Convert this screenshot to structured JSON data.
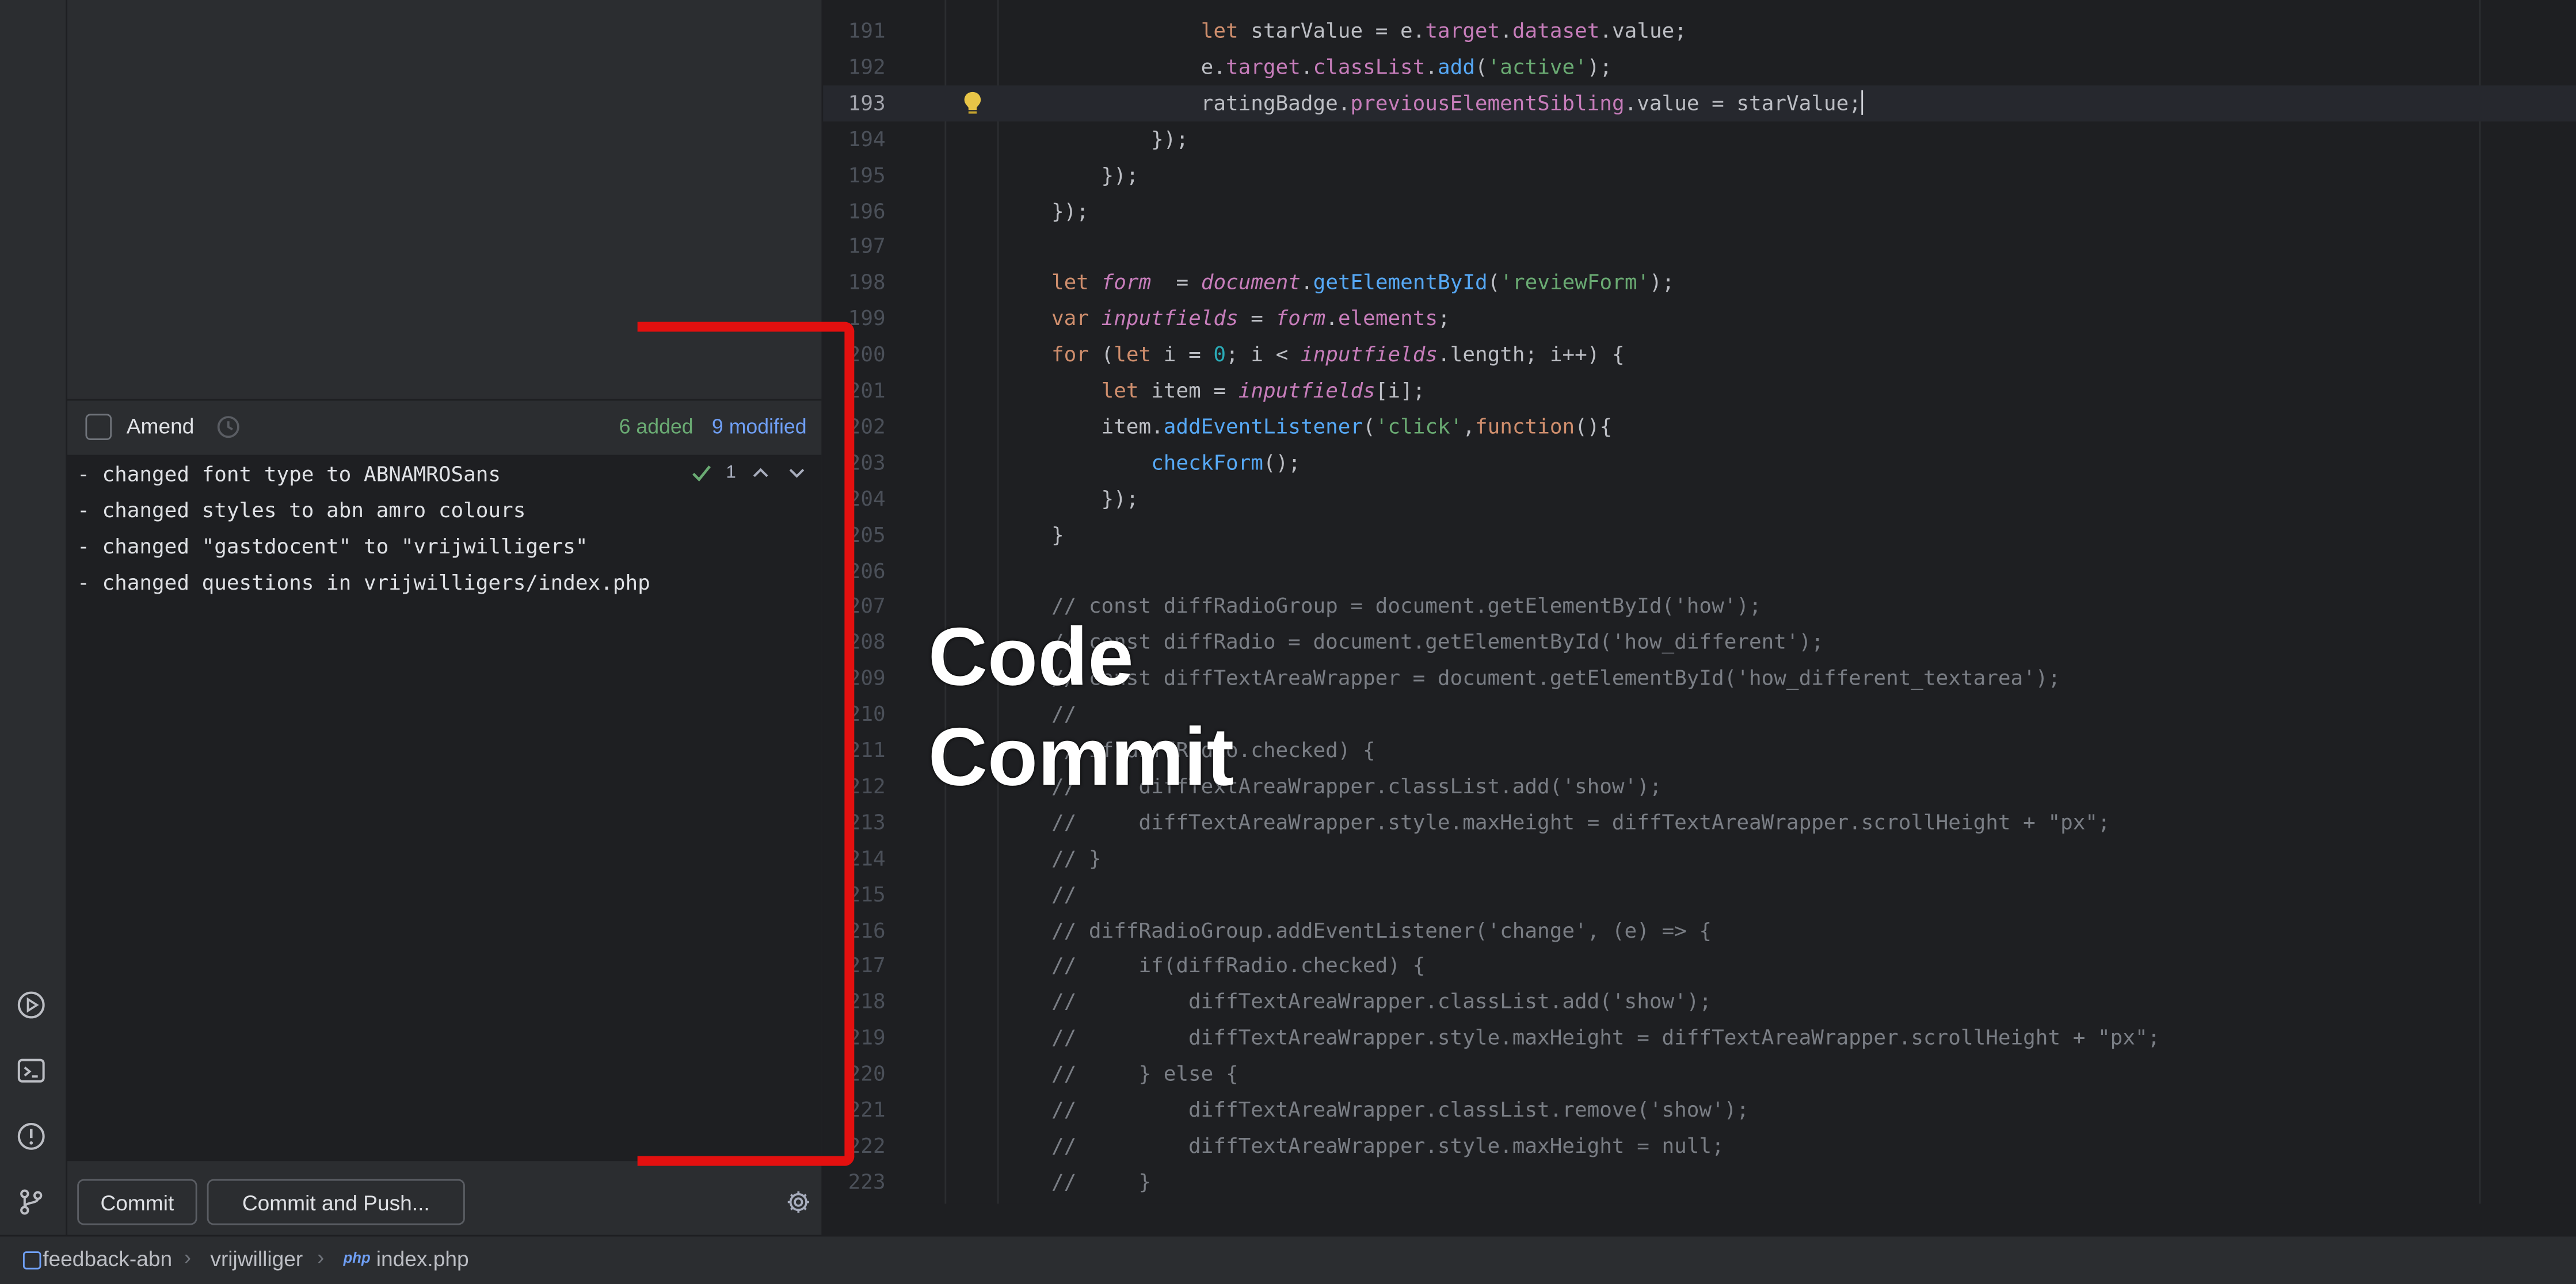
{
  "commit_panel": {
    "amend_label": "Amend",
    "added_label": "6 added",
    "modified_label": "9 modified",
    "check_count": "1",
    "message_lines": [
      "- changed font type to ABNAMROSans",
      "- changed styles to abn amro colours",
      "- changed \"gastdocent\" to \"vrijwilligers\"",
      "- changed questions in vrijwilligers/index.php"
    ],
    "commit_button": "Commit",
    "commit_push_button": "Commit and Push..."
  },
  "editor": {
    "lines": [
      {
        "n": "191",
        "text": "                let starValue = e.target.dataset.value;"
      },
      {
        "n": "192",
        "text": "                e.target.classList.add('active');"
      },
      {
        "n": "193",
        "text": "                ratingBadge.previousElementSibling.value = starValue;"
      },
      {
        "n": "194",
        "text": "            });"
      },
      {
        "n": "195",
        "text": "        });"
      },
      {
        "n": "196",
        "text": "    });"
      },
      {
        "n": "197",
        "text": ""
      },
      {
        "n": "198",
        "text": "    let form  = document.getElementById('reviewForm');"
      },
      {
        "n": "199",
        "text": "    var inputfields = form.elements;"
      },
      {
        "n": "200",
        "text": "    for (let i = 0; i < inputfields.length; i++) {"
      },
      {
        "n": "201",
        "text": "        let item = inputfields[i];"
      },
      {
        "n": "202",
        "text": "        item.addEventListener('click',function(){"
      },
      {
        "n": "203",
        "text": "            checkForm();"
      },
      {
        "n": "204",
        "text": "        });"
      },
      {
        "n": "205",
        "text": "    }"
      },
      {
        "n": "206",
        "text": ""
      },
      {
        "n": "207",
        "text": "    // const diffRadioGroup = document.getElementById('how');"
      },
      {
        "n": "208",
        "text": "    // const diffRadio = document.getElementById('how_different');"
      },
      {
        "n": "209",
        "text": "    // const diffTextAreaWrapper = document.getElementById('how_different_textarea');"
      },
      {
        "n": "210",
        "text": "    //"
      },
      {
        "n": "211",
        "text": "    // if(diffRadio.checked) {"
      },
      {
        "n": "212",
        "text": "    //     diffTextAreaWrapper.classList.add('show');"
      },
      {
        "n": "213",
        "text": "    //     diffTextAreaWrapper.style.maxHeight = diffTextAreaWrapper.scrollHeight + \"px\";"
      },
      {
        "n": "214",
        "text": "    // }"
      },
      {
        "n": "215",
        "text": "    //"
      },
      {
        "n": "216",
        "text": "    // diffRadioGroup.addEventListener('change', (e) => {"
      },
      {
        "n": "217",
        "text": "    //     if(diffRadio.checked) {"
      },
      {
        "n": "218",
        "text": "    //         diffTextAreaWrapper.classList.add('show');"
      },
      {
        "n": "219",
        "text": "    //         diffTextAreaWrapper.style.maxHeight = diffTextAreaWrapper.scrollHeight + \"px\";"
      },
      {
        "n": "220",
        "text": "    //     } else {"
      },
      {
        "n": "221",
        "text": "    //         diffTextAreaWrapper.classList.remove('show');"
      },
      {
        "n": "222",
        "text": "    //         diffTextAreaWrapper.style.maxHeight = null;"
      },
      {
        "n": "223",
        "text": "    //     }"
      }
    ]
  },
  "overlay": {
    "title_line1": "Code",
    "title_line2": "Commit",
    "bracket_color": "#e3100f"
  },
  "statusbar": {
    "crumbs": [
      "feedback-abn",
      "vrijwilliger",
      "index.php"
    ],
    "file_type": "php"
  },
  "icons": {
    "toolstrip": [
      "run-icon",
      "terminal-icon",
      "problems-icon",
      "git-branch-icon"
    ]
  }
}
